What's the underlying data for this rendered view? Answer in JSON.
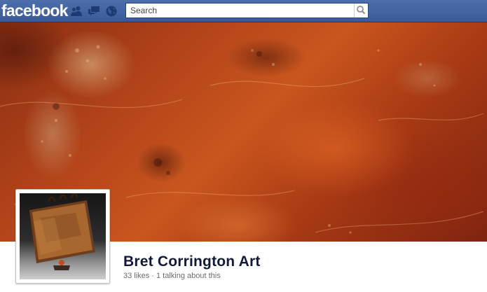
{
  "header": {
    "logo_text": "facebook",
    "brand_color": "#3b5998",
    "jewels": [
      {
        "icon": "friend-requests-icon"
      },
      {
        "icon": "messages-icon"
      },
      {
        "icon": "notifications-globe-icon"
      }
    ],
    "search": {
      "placeholder": "Search",
      "value": "",
      "button_icon": "magnifier-icon"
    }
  },
  "cover": {
    "description_icon": "cover-photo"
  },
  "page": {
    "name": "Bret Corrington Art",
    "likes": "33 likes",
    "separator": "·",
    "talking": "1 talking about this"
  }
}
